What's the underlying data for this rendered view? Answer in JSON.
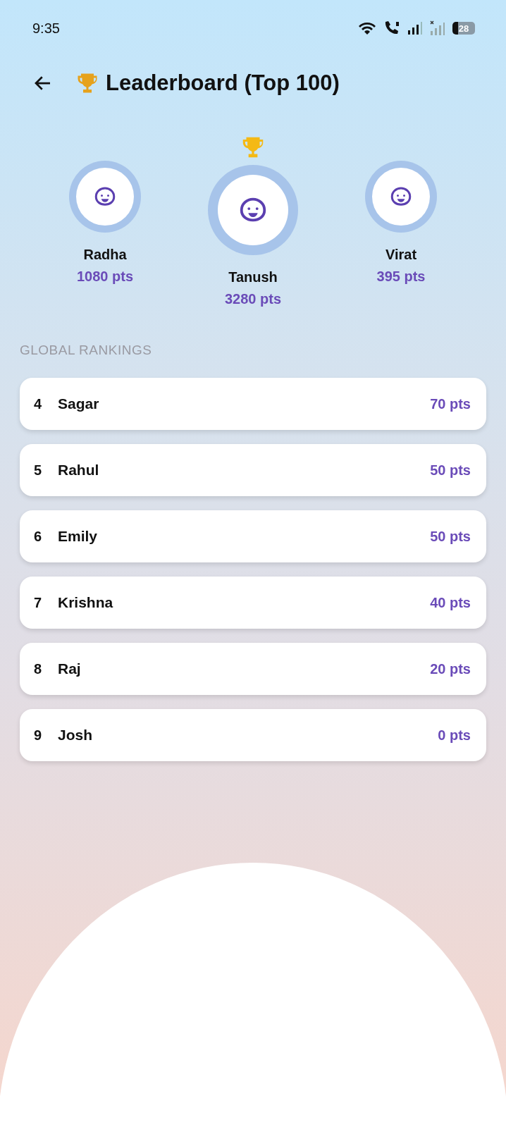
{
  "status_bar": {
    "time": "9:35",
    "battery": "28"
  },
  "header": {
    "title": "Leaderboard (Top 100)"
  },
  "podium": [
    {
      "name": "Radha",
      "points": "1080 pts",
      "winner": false
    },
    {
      "name": "Tanush",
      "points": "3280 pts",
      "winner": true
    },
    {
      "name": "Virat",
      "points": "395 pts",
      "winner": false
    }
  ],
  "section_title": "GLOBAL RANKINGS",
  "rankings": [
    {
      "rank": "4",
      "name": "Sagar",
      "points": "70 pts"
    },
    {
      "rank": "5",
      "name": "Rahul",
      "points": "50 pts"
    },
    {
      "rank": "6",
      "name": "Emily",
      "points": "50 pts"
    },
    {
      "rank": "7",
      "name": "Krishna",
      "points": "40 pts"
    },
    {
      "rank": "8",
      "name": "Raj",
      "points": "20 pts"
    },
    {
      "rank": "9",
      "name": "Josh",
      "points": "0 pts"
    }
  ]
}
